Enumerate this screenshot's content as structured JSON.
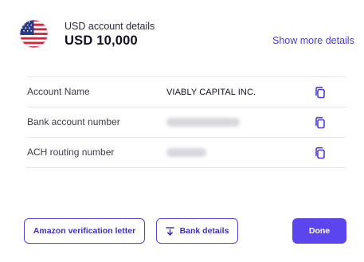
{
  "header": {
    "title": "USD account details",
    "amount": "USD 10,000",
    "show_more_label": "Show more details",
    "flag_icon": "us-flag-icon"
  },
  "rows": [
    {
      "label": "Account Name",
      "value": "VIABLY CAPITAL INC.",
      "masked": false,
      "icon": "copy-icon"
    },
    {
      "label": "Bank account number",
      "value": "",
      "masked": true,
      "icon": "copy-icon"
    },
    {
      "label": "ACH routing number",
      "value": "",
      "masked": true,
      "icon": "copy-icon"
    }
  ],
  "buttons": {
    "amazon_label": "Amazon verification letter",
    "bank_label": "Bank details",
    "bank_icon": "download-icon",
    "done_label": "Done"
  },
  "colors": {
    "accent": "#5b45ef",
    "link": "#4b3fcf",
    "outline": "#5448d6"
  }
}
